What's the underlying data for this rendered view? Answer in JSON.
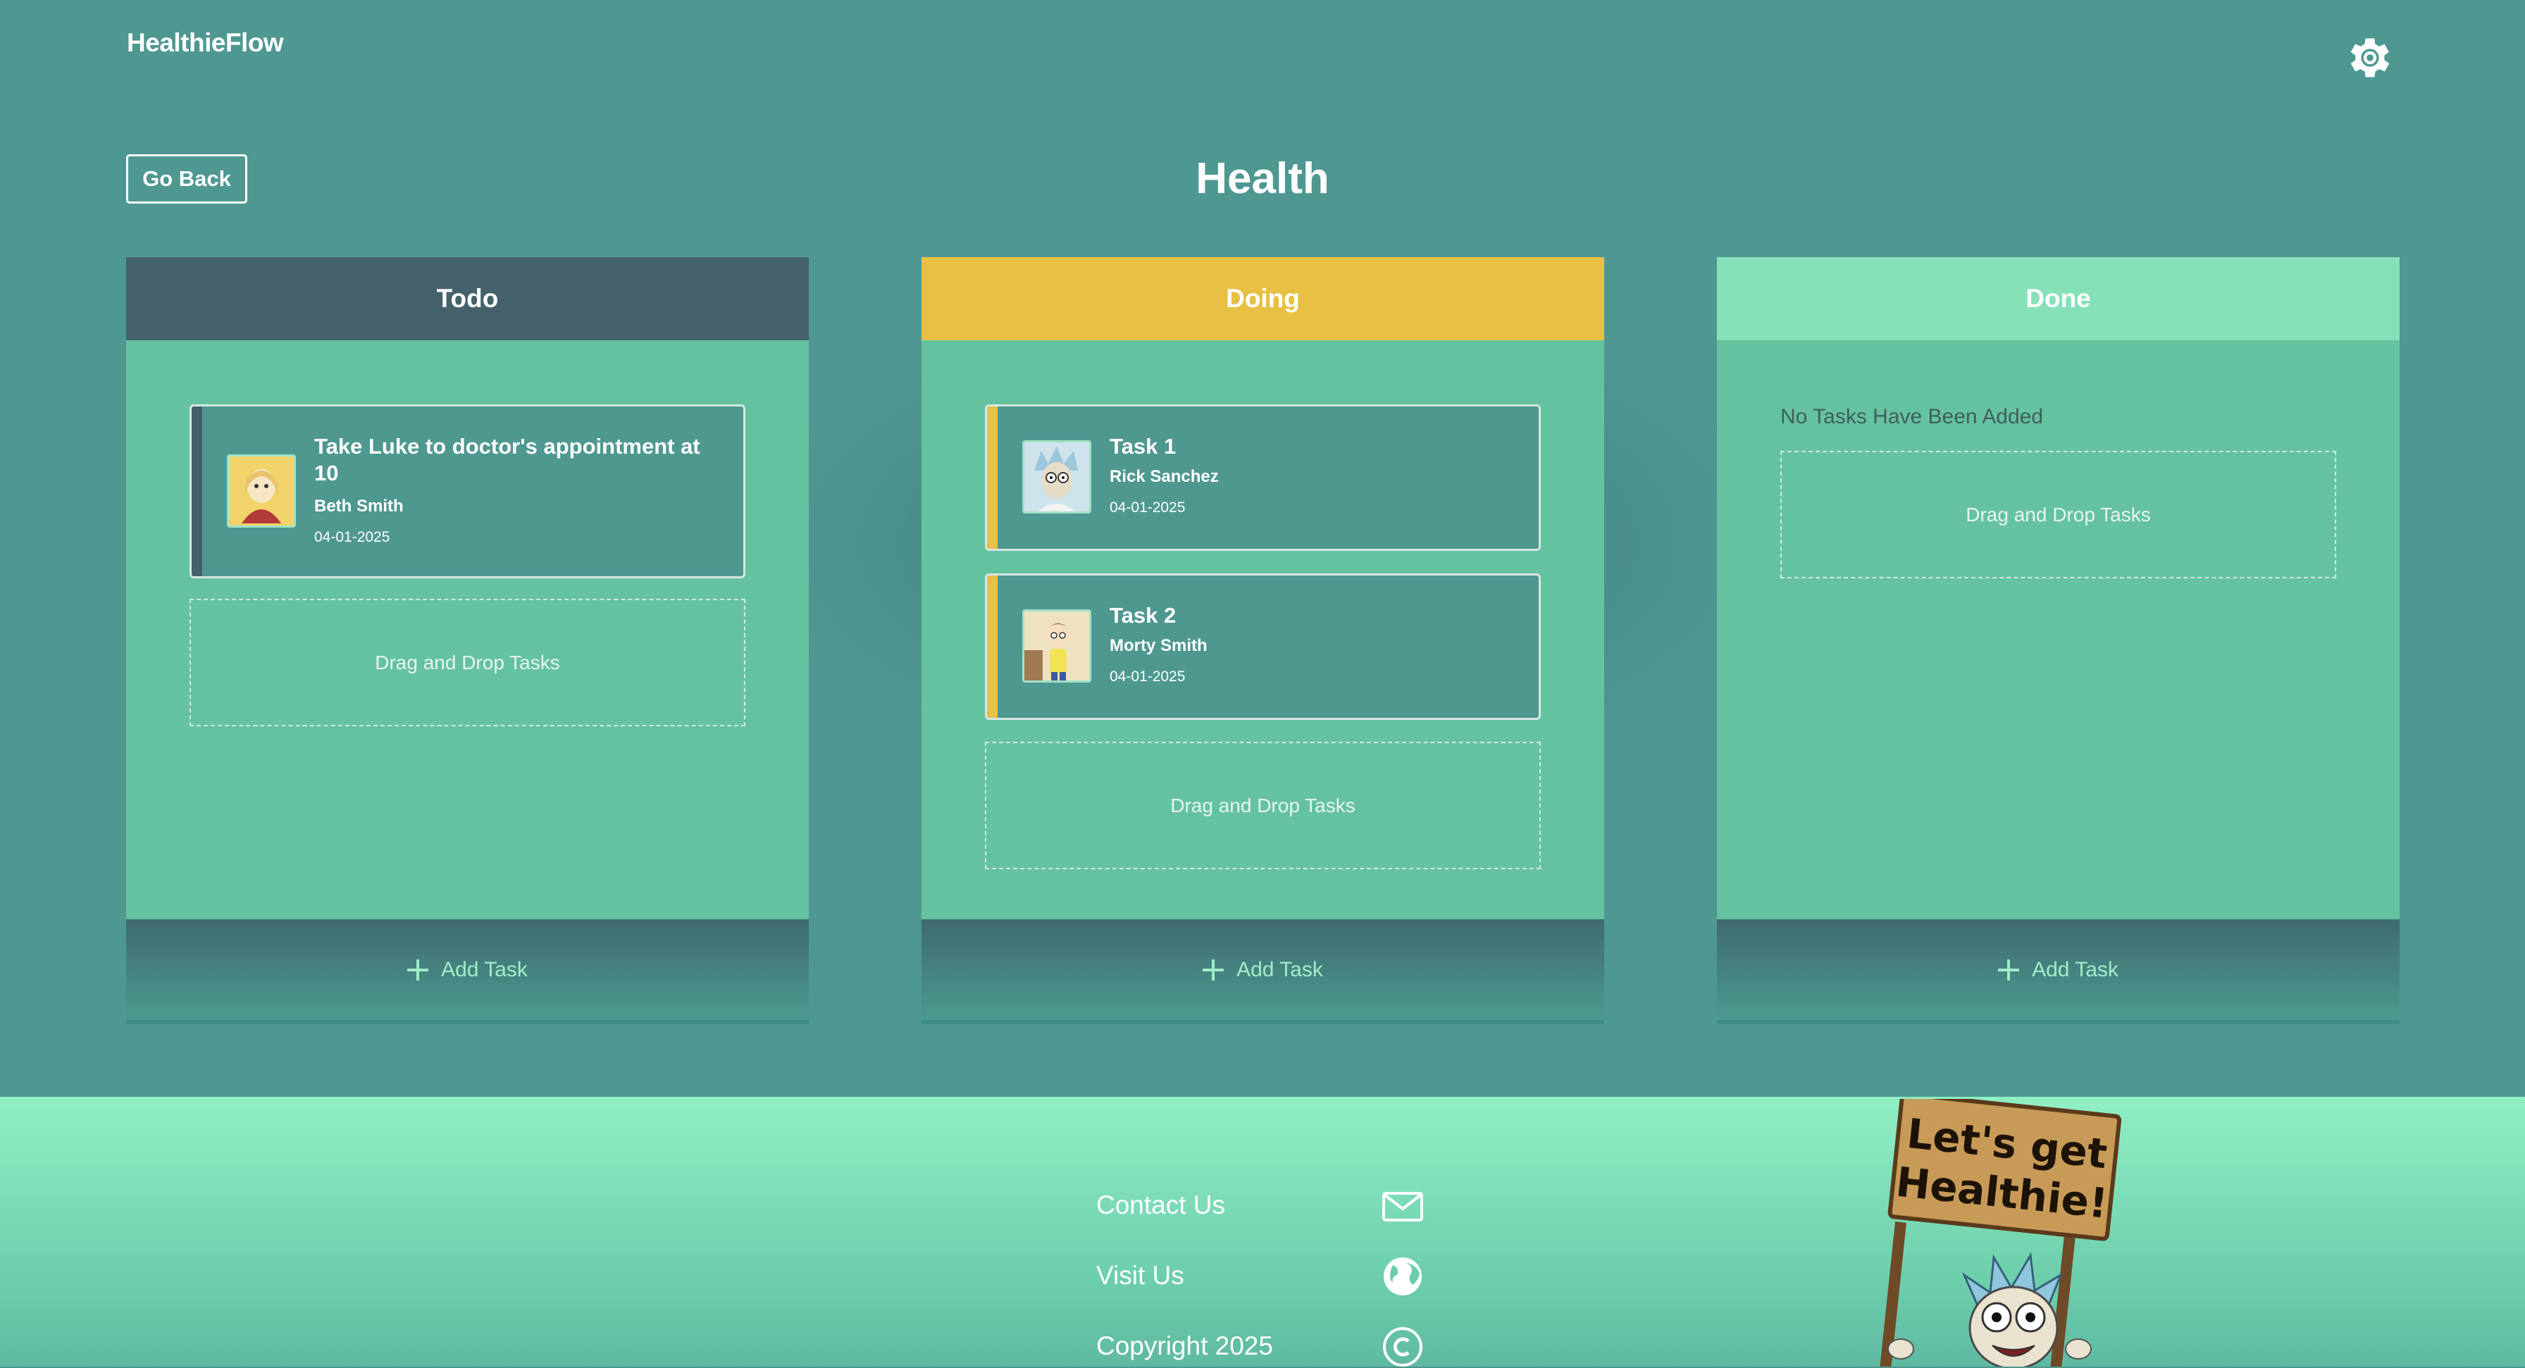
{
  "app": {
    "brand": "HealthieFlow"
  },
  "nav": {
    "go_back": "Go Back"
  },
  "board": {
    "title": "Health"
  },
  "columns": [
    {
      "title": "Todo",
      "header_color": "#44616c",
      "add_label": "Add Task",
      "dropzone": "Drag and Drop Tasks",
      "tasks": [
        {
          "title": "Take Luke to doctor's appointment at 10",
          "assignee": "Beth Smith",
          "date": "04-01-2025",
          "stripe_color": "#44616c"
        }
      ]
    },
    {
      "title": "Doing",
      "header_color": "#e8c043",
      "add_label": "Add Task",
      "dropzone": "Drag and Drop Tasks",
      "tasks": [
        {
          "title": "Task 1",
          "assignee": "Rick Sanchez",
          "date": "04-01-2025",
          "stripe_color": "#e8c043"
        },
        {
          "title": "Task 2",
          "assignee": "Morty Smith",
          "date": "04-01-2025",
          "stripe_color": "#e8c043"
        }
      ]
    },
    {
      "title": "Done",
      "header_color": "#86e1b8",
      "add_label": "Add Task",
      "dropzone": "Drag and Drop Tasks",
      "empty_message": "No Tasks Have Been Added",
      "tasks": []
    }
  ],
  "footer": {
    "contact": "Contact Us",
    "visit": "Visit Us",
    "copyright": "Copyright 2025",
    "icons": [
      "mail-icon",
      "globe-icon",
      "copyright-icon"
    ]
  },
  "mascot": {
    "sign_line1": "Let's get",
    "sign_line2": "Healthie!"
  },
  "colors": {
    "background": "#4e9891",
    "column_body": "#65c2a1",
    "footer": "#91efc5",
    "text_light": "#ffffff"
  }
}
